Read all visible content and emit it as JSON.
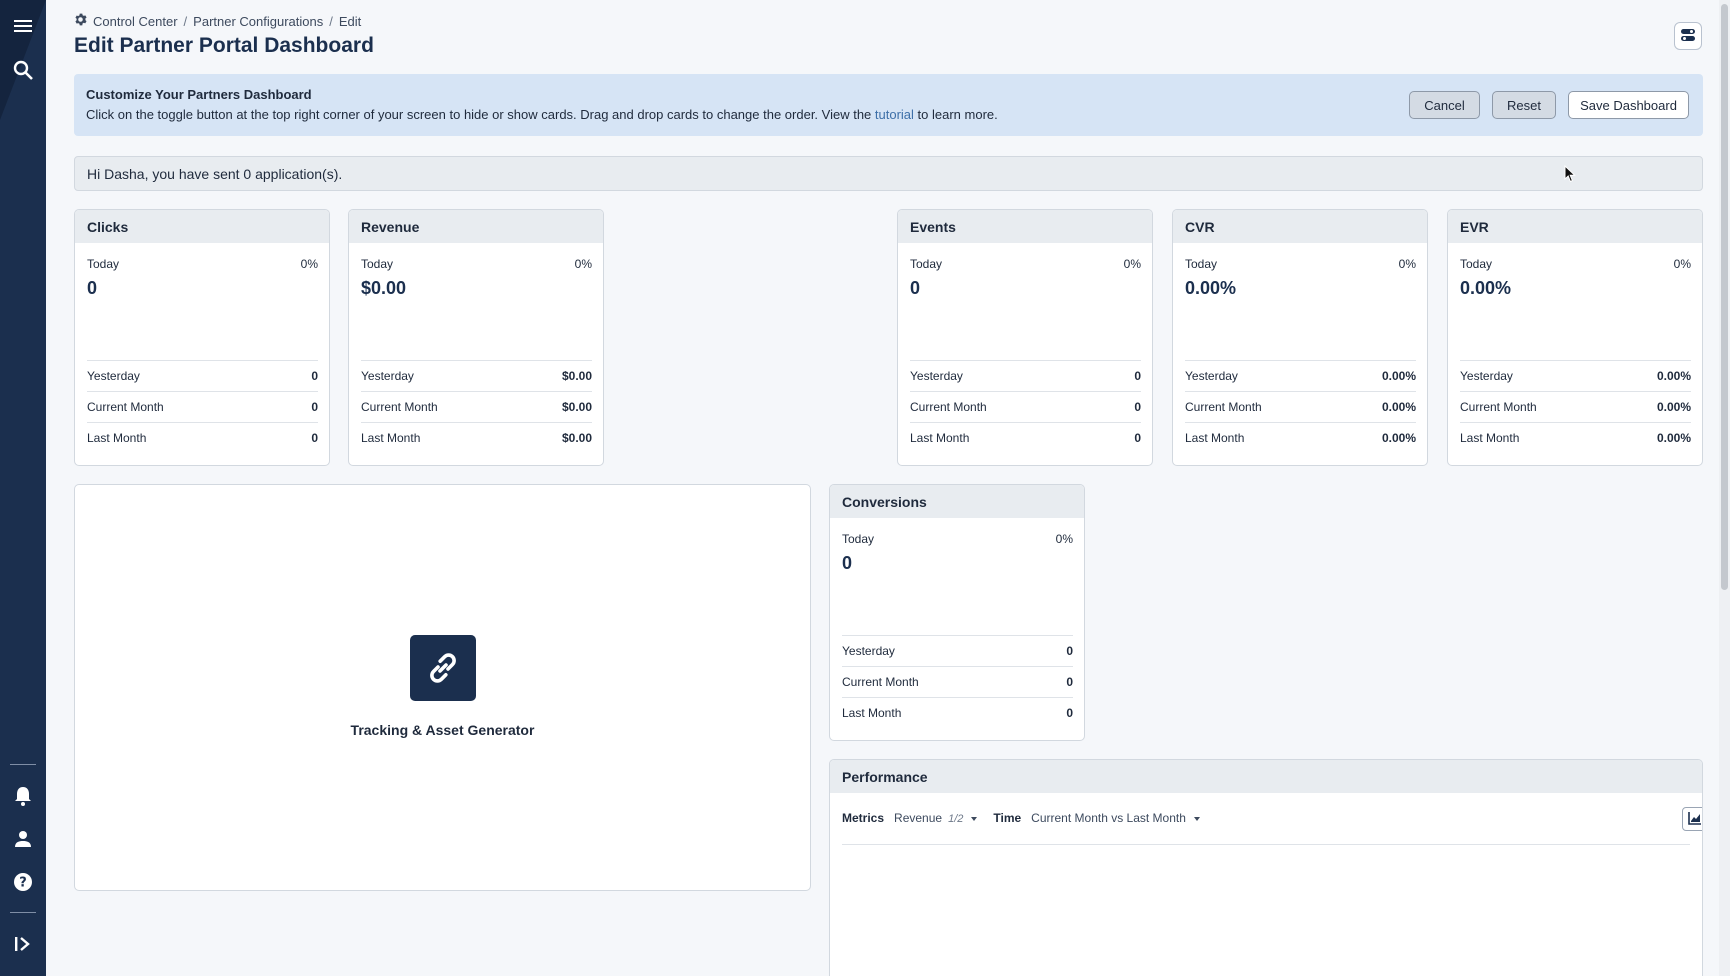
{
  "breadcrumb": {
    "items": [
      "Control Center",
      "Partner Configurations",
      "Edit"
    ]
  },
  "page": {
    "title": "Edit Partner Portal Dashboard"
  },
  "info": {
    "heading": "Customize Your Partners Dashboard",
    "text_before": "Click on the toggle button at the top right corner of your screen to hide or show cards. Drag and drop cards to change the order. View the ",
    "link": "tutorial",
    "text_after": " to learn more.",
    "cancel_label": "Cancel",
    "reset_label": "Reset",
    "save_label": "Save Dashboard"
  },
  "greeting": "Hi Dasha, you have sent 0 application(s).",
  "cards": [
    {
      "title": "Clicks",
      "today_label": "Today",
      "pct": "0%",
      "today_value": "0",
      "rows": [
        {
          "label": "Yesterday",
          "value": "0"
        },
        {
          "label": "Current Month",
          "value": "0"
        },
        {
          "label": "Last Month",
          "value": "0"
        }
      ]
    },
    {
      "title": "Revenue",
      "today_label": "Today",
      "pct": "0%",
      "today_value": "$0.00",
      "rows": [
        {
          "label": "Yesterday",
          "value": "$0.00"
        },
        {
          "label": "Current Month",
          "value": "$0.00"
        },
        {
          "label": "Last Month",
          "value": "$0.00"
        }
      ]
    },
    {
      "title": "Events",
      "today_label": "Today",
      "pct": "0%",
      "today_value": "0",
      "rows": [
        {
          "label": "Yesterday",
          "value": "0"
        },
        {
          "label": "Current Month",
          "value": "0"
        },
        {
          "label": "Last Month",
          "value": "0"
        }
      ]
    },
    {
      "title": "CVR",
      "today_label": "Today",
      "pct": "0%",
      "today_value": "0.00%",
      "rows": [
        {
          "label": "Yesterday",
          "value": "0.00%"
        },
        {
          "label": "Current Month",
          "value": "0.00%"
        },
        {
          "label": "Last Month",
          "value": "0.00%"
        }
      ]
    },
    {
      "title": "EVR",
      "today_label": "Today",
      "pct": "0%",
      "today_value": "0.00%",
      "rows": [
        {
          "label": "Yesterday",
          "value": "0.00%"
        },
        {
          "label": "Current Month",
          "value": "0.00%"
        },
        {
          "label": "Last Month",
          "value": "0.00%"
        }
      ]
    },
    {
      "title": "Conversions",
      "today_label": "Today",
      "pct": "0%",
      "today_value": "0",
      "rows": [
        {
          "label": "Yesterday",
          "value": "0"
        },
        {
          "label": "Current Month",
          "value": "0"
        },
        {
          "label": "Last Month",
          "value": "0"
        }
      ]
    }
  ],
  "tracker": {
    "label": "Tracking & Asset Generator",
    "icon": "link-icon"
  },
  "performance": {
    "title": "Performance",
    "metrics_label": "Metrics",
    "metrics_value": "Revenue",
    "metrics_count": "1/2",
    "time_label": "Time",
    "time_value": "Current Month vs Last Month",
    "icons": [
      "line-chart-icon",
      "bar-chart-icon"
    ]
  },
  "rail": {
    "icons": [
      "menu-icon",
      "search-icon",
      "bell-icon",
      "user-icon",
      "help-icon",
      "expand-icon"
    ]
  },
  "colors": {
    "rail": "#1b2f4e",
    "info_bg": "#d6e4f5",
    "link": "#3d6fa8"
  }
}
